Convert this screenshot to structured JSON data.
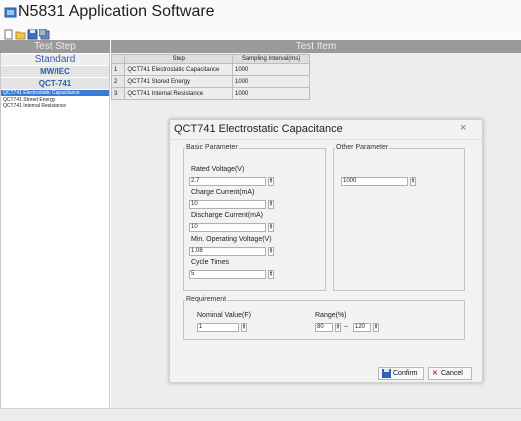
{
  "app": {
    "title": "N5831 Application Software"
  },
  "toolbar": {
    "icons": [
      "new-icon",
      "open-icon",
      "save-icon",
      "save-all-icon"
    ]
  },
  "headers": {
    "left": "Test Step",
    "right": "Test Item"
  },
  "left_pane": {
    "standard_label": "Standard",
    "categories": [
      "MW/IEC",
      "QCT-741"
    ],
    "items": [
      "QCT741 Electrostatic Capacitance",
      "QCT741 Stored Energy",
      "QCT741 Internal Resistance"
    ],
    "selected_index": 0
  },
  "table": {
    "columns": [
      "",
      "Step",
      "Sampling Interval(ms)"
    ],
    "rows": [
      [
        "1",
        "QCT741 Electrostatic Capacitance",
        "1000"
      ],
      [
        "2",
        "QCT741 Stored Energy",
        "1000"
      ],
      [
        "3",
        "QCT741 Internal Resistance",
        "1000"
      ]
    ]
  },
  "dialog": {
    "title": "QCT741 Electrostatic Capacitance",
    "close": "×",
    "basic": {
      "label": "Basic Parameter",
      "rated_voltage": {
        "label": "Rated Voltage(V)",
        "value": "2.7"
      },
      "charge_current": {
        "label": "Charge Current(mA)",
        "value": "10"
      },
      "discharge_current": {
        "label": "Discharge Current(mA)",
        "value": "10"
      },
      "min_voltage": {
        "label": "Min. Operating Voltage(V)",
        "value": "1.08"
      },
      "cycle_times": {
        "label": "Cycle Times",
        "value": "5"
      }
    },
    "other": {
      "label": "Other Parameter",
      "value": "1000"
    },
    "requirement": {
      "label": "Requirement",
      "nominal": {
        "label": "Nominal Value(F)",
        "value": "1"
      },
      "range": {
        "label": "Range(%)",
        "low": "80",
        "sep": "~",
        "high": "120"
      }
    },
    "confirm": "Confirm",
    "cancel": "Cancel"
  }
}
